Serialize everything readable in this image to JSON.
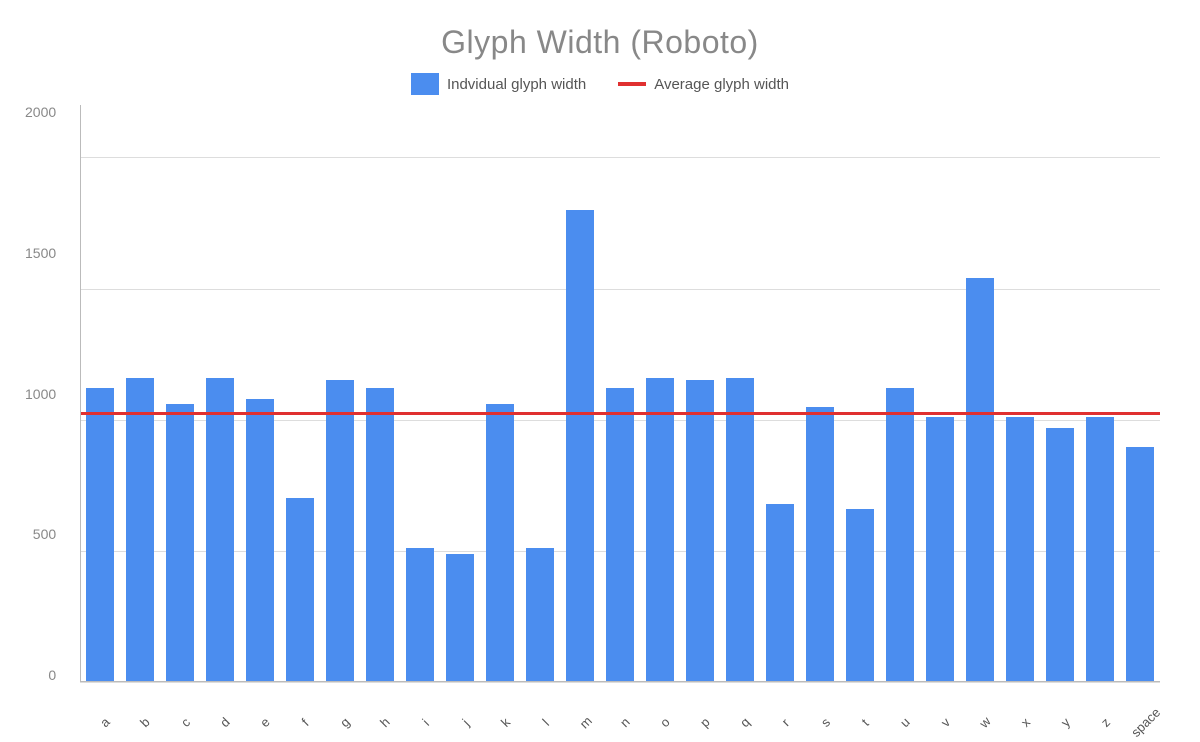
{
  "title": "Glyph Width (Roboto)",
  "legend": {
    "bar_label": "Indvidual glyph width",
    "line_label": "Average glyph width"
  },
  "chart": {
    "y_max": 2200,
    "y_labels": [
      "2000",
      "1500",
      "1000",
      "500",
      "0"
    ],
    "average_value": 1030,
    "bars": [
      {
        "letter": "a",
        "value": 1120
      },
      {
        "letter": "b",
        "value": 1160
      },
      {
        "letter": "c",
        "value": 1060
      },
      {
        "letter": "d",
        "value": 1160
      },
      {
        "letter": "e",
        "value": 1080
      },
      {
        "letter": "f",
        "value": 700
      },
      {
        "letter": "g",
        "value": 1150
      },
      {
        "letter": "h",
        "value": 1120
      },
      {
        "letter": "i",
        "value": 510
      },
      {
        "letter": "j",
        "value": 490
      },
      {
        "letter": "k",
        "value": 1060
      },
      {
        "letter": "l",
        "value": 510
      },
      {
        "letter": "m",
        "value": 1800
      },
      {
        "letter": "n",
        "value": 1120
      },
      {
        "letter": "o",
        "value": 1160
      },
      {
        "letter": "p",
        "value": 1150
      },
      {
        "letter": "q",
        "value": 1160
      },
      {
        "letter": "r",
        "value": 680
      },
      {
        "letter": "s",
        "value": 1050
      },
      {
        "letter": "t",
        "value": 660
      },
      {
        "letter": "u",
        "value": 1120
      },
      {
        "letter": "v",
        "value": 1010
      },
      {
        "letter": "w",
        "value": 1540
      },
      {
        "letter": "x",
        "value": 1010
      },
      {
        "letter": "y",
        "value": 970
      },
      {
        "letter": "z",
        "value": 1010
      },
      {
        "letter": "space",
        "value": 895
      }
    ]
  },
  "colors": {
    "bar": "#4b8def",
    "avg_line": "#e03030",
    "grid": "#dddddd",
    "axis": "#bbbbbb",
    "title": "#888888",
    "label": "#555555",
    "y_label": "#888888"
  }
}
